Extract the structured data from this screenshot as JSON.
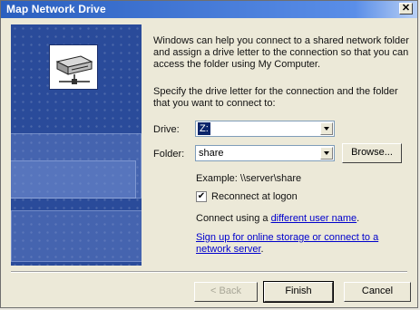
{
  "window": {
    "title": "Map Network Drive"
  },
  "intro_text": "Windows can help you connect to a shared network folder and assign a drive letter to the connection so that you can access the folder using My Computer.",
  "specify_text": "Specify the drive letter for the connection and the folder that you want to connect to:",
  "drive": {
    "label": "Drive:",
    "value": "Z:"
  },
  "folder": {
    "label": "Folder:",
    "value": "share",
    "browse_label": "Browse..."
  },
  "example_text": "Example: \\\\server\\share",
  "reconnect": {
    "label": "Reconnect at logon",
    "checked": true
  },
  "connect_prefix": "Connect using a ",
  "connect_link": "different user name",
  "connect_suffix": ".",
  "signup_link": "Sign up for online storage or connect to a network server",
  "signup_suffix": ".",
  "buttons": {
    "back": "< Back",
    "finish": "Finish",
    "cancel": "Cancel"
  },
  "icons": {
    "close": "close-icon",
    "hero": "network-drive-icon",
    "check": "checkmark-icon"
  }
}
